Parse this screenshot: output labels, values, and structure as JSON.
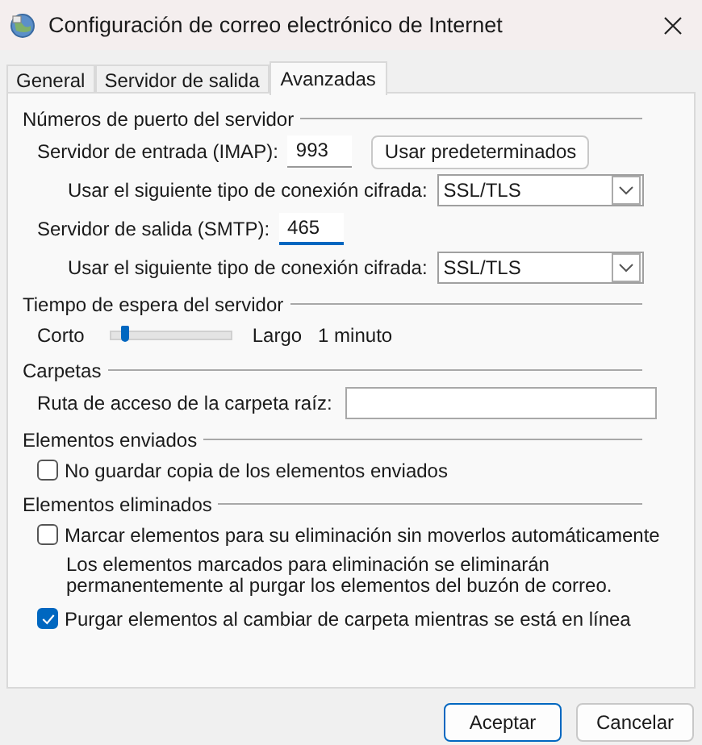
{
  "window": {
    "title": "Configuración de correo electrónico de Internet"
  },
  "tabs": [
    {
      "label": "General",
      "selected": false
    },
    {
      "label": "Servidor de salida",
      "selected": false
    },
    {
      "label": "Avanzadas",
      "selected": true
    }
  ],
  "server_ports": {
    "title": "Números de puerto del servidor",
    "incoming": {
      "label": "Servidor de entrada (IMAP):",
      "value": "993",
      "focused": false
    },
    "defaults_button": "Usar predeterminados",
    "incoming_encryption": {
      "label": "Usar el siguiente tipo de conexión cifrada:",
      "value": "SSL/TLS"
    },
    "outgoing": {
      "label": "Servidor de salida (SMTP):",
      "value": "465",
      "focused": true
    },
    "outgoing_encryption": {
      "label": "Usar el siguiente tipo de conexión cifrada:",
      "value": "SSL/TLS"
    }
  },
  "timeout": {
    "title": "Tiempo de espera del servidor",
    "short_label": "Corto",
    "long_label": "Largo",
    "level": 0.1,
    "reading": "1 minuto"
  },
  "folders": {
    "title": "Carpetas",
    "root_label": "Ruta de acceso de la carpeta raíz:"
  },
  "sent_items": {
    "title": "Elementos enviados",
    "options": [
      {
        "kind": "checkbox",
        "label": "No guardar copia de los elementos enviados",
        "checked": false
      }
    ]
  },
  "deleted_items": {
    "title": "Elementos eliminados",
    "options": [
      {
        "kind": "checkbox",
        "label": "Marcar elementos para su eliminación sin moverlos automáticamente",
        "checked": false
      },
      {
        "kind": "note",
        "label": "Los elementos marcados para eliminación se eliminarán permanentemente al purgar los elementos del buzón de correo."
      },
      {
        "kind": "checkbox",
        "label": "Purgar elementos al cambiar de carpeta mientras se está en línea",
        "checked": true
      }
    ]
  },
  "buttons": [
    {
      "label": "Aceptar",
      "default": true
    },
    {
      "label": "Cancelar",
      "default": false
    }
  ]
}
